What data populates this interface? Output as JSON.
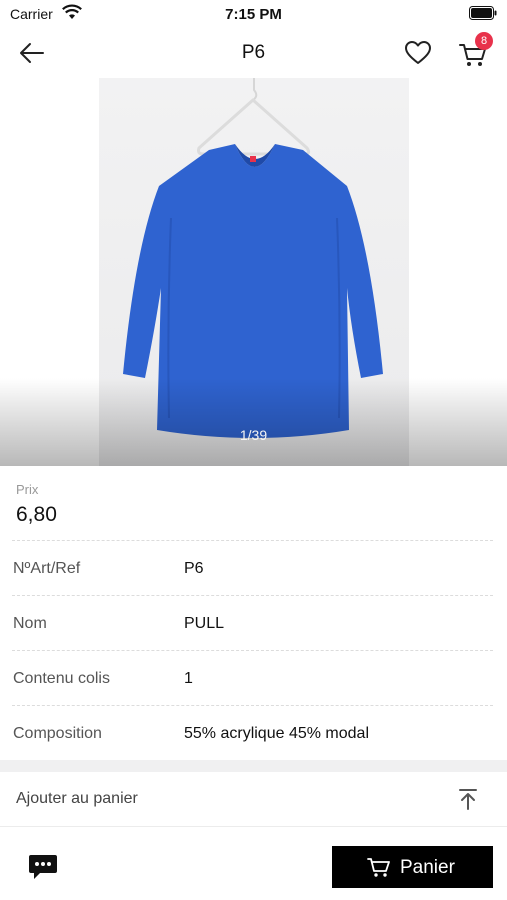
{
  "status_bar": {
    "carrier": "Carrier",
    "time": "7:15 PM"
  },
  "nav": {
    "title": "P6",
    "back_icon": "arrow-left-icon",
    "favorite_icon": "heart-icon",
    "cart_icon": "cart-icon",
    "cart_count": "8",
    "badge_color": "#e8324b"
  },
  "product_image": {
    "counter": "1/39",
    "garment_color": "#2f63d0"
  },
  "price": {
    "label": "Prix",
    "value": "6,80"
  },
  "details": [
    {
      "label": "NºArt/Ref",
      "value": "P6"
    },
    {
      "label": "Nom",
      "value": "PULL"
    },
    {
      "label": "Contenu colis",
      "value": "1"
    },
    {
      "label": "Composition",
      "value": "55% acrylique 45% modal"
    }
  ],
  "add_to_cart": {
    "label": "Ajouter au panier",
    "icon": "scroll-top-icon"
  },
  "footer": {
    "chat_icon": "chat-icon",
    "panier_label": "Panier",
    "panier_icon": "cart-icon"
  }
}
